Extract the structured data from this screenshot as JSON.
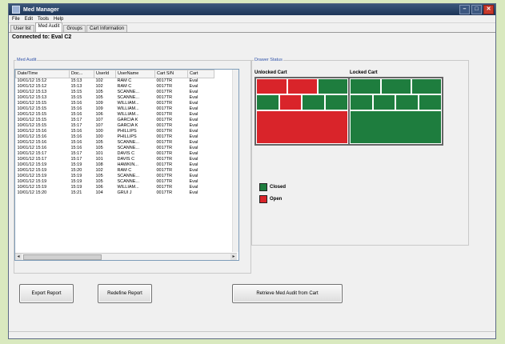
{
  "window": {
    "title": "Med Manager"
  },
  "menu": [
    "File",
    "Edit",
    "Tools",
    "Help"
  ],
  "tabs": [
    "User list",
    "Med Audit",
    "Groups",
    "Cart Information"
  ],
  "connection_text": "Connected to: Eval C2",
  "med_audit": {
    "legend": "Med Audit",
    "columns": [
      "Date/Time",
      "Doc...",
      "UserId",
      "UserName",
      "Cart S/N",
      "Cart"
    ],
    "rows": [
      [
        "10/01/12 15:12",
        "15:13",
        "102",
        "RAM C",
        "0017TR",
        "Eval"
      ],
      [
        "10/01/12 15:12",
        "15:13",
        "102",
        "RAM C",
        "0017TR",
        "Eval"
      ],
      [
        "10/01/12 15:13",
        "15:15",
        "105",
        "SCANNE...",
        "0017TR",
        "Eval"
      ],
      [
        "10/01/12 15:13",
        "15:15",
        "105",
        "SCANNE...",
        "0017TR",
        "Eval"
      ],
      [
        "10/01/12 15:15",
        "15:16",
        "109",
        "WILLIAM...",
        "0017TR",
        "Eval"
      ],
      [
        "10/01/12 15:15",
        "15:16",
        "109",
        "WILLIAM...",
        "0017TR",
        "Eval"
      ],
      [
        "10/01/12 15:15",
        "15:16",
        "106",
        "WILLIAM...",
        "0017TR",
        "Eval"
      ],
      [
        "10/01/12 15:15",
        "15:17",
        "107",
        "GARCIA K",
        "0017TR",
        "Eval"
      ],
      [
        "10/01/12 15:15",
        "15:17",
        "107",
        "GARCIA K",
        "0017TR",
        "Eval"
      ],
      [
        "10/01/12 15:16",
        "15:16",
        "100",
        "PHILLIPS",
        "0017TR",
        "Eval"
      ],
      [
        "10/01/12 15:16",
        "15:16",
        "100",
        "PHILLIPS",
        "0017TR",
        "Eval"
      ],
      [
        "10/01/12 15:16",
        "15:16",
        "105",
        "SCANNE...",
        "0017TR",
        "Eval"
      ],
      [
        "10/01/12 15:16",
        "15:16",
        "105",
        "SCANNE...",
        "0017TR",
        "Eval"
      ],
      [
        "10/01/12 15:17",
        "15:17",
        "101",
        "DAVIS C",
        "0017TR",
        "Eval"
      ],
      [
        "10/01/12 15:17",
        "15:17",
        "101",
        "DAVIS C",
        "0017TR",
        "Eval"
      ],
      [
        "10/01/12 15:19",
        "15:19",
        "108",
        "HAWKIN...",
        "0017TR",
        "Eval"
      ],
      [
        "10/01/12 15:19",
        "15:20",
        "102",
        "RAM C",
        "0017TR",
        "Eval"
      ],
      [
        "10/01/12 15:19",
        "15:19",
        "105",
        "SCANNE...",
        "0017TR",
        "Eval"
      ],
      [
        "10/01/12 15:19",
        "15:19",
        "105",
        "SCANNE...",
        "0017TR",
        "Eval"
      ],
      [
        "10/01/12 15:19",
        "15:19",
        "106",
        "WILLIAM...",
        "0017TR",
        "Eval"
      ],
      [
        "10/01/12 15:20",
        "15:21",
        "104",
        "GRUI J",
        "0017TR",
        "Eval"
      ]
    ]
  },
  "drawer_status": {
    "legend": "Drawer Status",
    "unlocked_label": "Unlocked Cart",
    "locked_label": "Locked Cart",
    "unlocked_cells": [
      "open",
      "open",
      "closed",
      "closed",
      "open",
      "closed",
      "closed",
      "open",
      "closed"
    ],
    "locked_cells": [
      "closed",
      "closed",
      "closed",
      "closed",
      "closed",
      "closed",
      "closed",
      "closed",
      "closed"
    ],
    "colors": {
      "closed": "#1e7d3e",
      "open": "#d9242a"
    },
    "legend_closed": "Closed",
    "legend_open": "Open"
  },
  "buttons": {
    "export": "Export Report",
    "redefine": "Redefine Report",
    "retrieve": "Retrieve Med Audit from Cart"
  }
}
